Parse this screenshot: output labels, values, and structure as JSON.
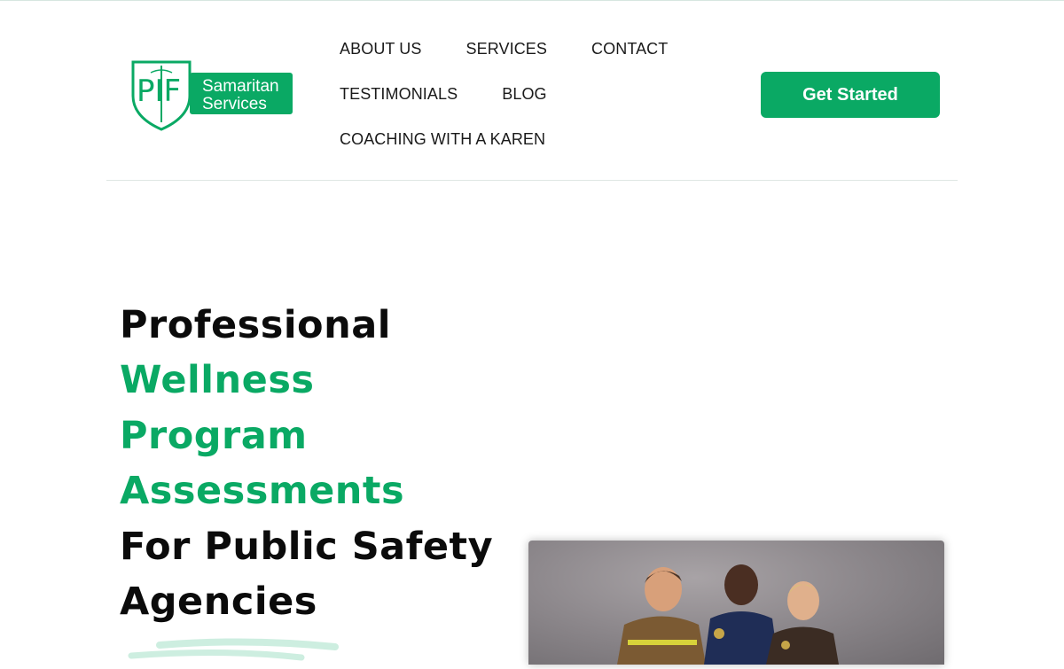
{
  "logo": {
    "monogram": "PIF",
    "line1": "Samaritan",
    "line2": "Services"
  },
  "nav": {
    "items": [
      {
        "label": "ABOUT US"
      },
      {
        "label": "SERVICES"
      },
      {
        "label": "CONTACT"
      },
      {
        "label": "TESTIMONIALS"
      },
      {
        "label": "BLOG"
      },
      {
        "label": "COACHING WITH A KAREN"
      }
    ]
  },
  "cta": {
    "label": "Get Started"
  },
  "hero": {
    "title_lines": [
      {
        "text": "Professional",
        "color": "#0b0b0b"
      },
      {
        "text": "Wellness",
        "color": "#0aa964"
      },
      {
        "text": "Program",
        "color": "#0aa964"
      },
      {
        "text": "Assessments",
        "color": "#0aa964"
      },
      {
        "text": "For Public Safety",
        "color": "#0b0b0b"
      },
      {
        "text": "Agencies",
        "color": "#0b0b0b"
      }
    ]
  },
  "colors": {
    "brand_green": "#0aa964",
    "text_dark": "#0b0b0b",
    "brush_mint": "#cdeee0"
  },
  "photo": {
    "subject_icon": "first-responders-photo"
  }
}
